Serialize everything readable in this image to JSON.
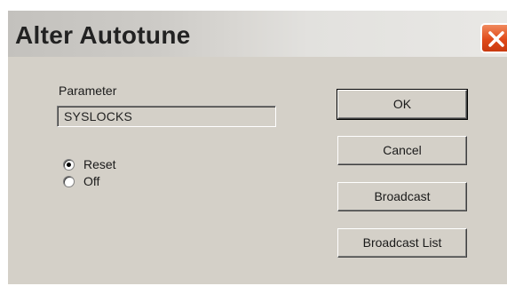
{
  "window": {
    "title": "Alter Autotune"
  },
  "parameter": {
    "label": "Parameter",
    "value": "SYSLOCKS"
  },
  "options": [
    {
      "label": "Reset",
      "selected": true
    },
    {
      "label": "Off",
      "selected": false
    }
  ],
  "buttons": {
    "ok": "OK",
    "cancel": "Cancel",
    "broadcast": "Broadcast",
    "broadcast_list": "Broadcast List"
  },
  "colors": {
    "dialog_bg": "#d4d0c8",
    "close_red": "#e04a1a"
  }
}
